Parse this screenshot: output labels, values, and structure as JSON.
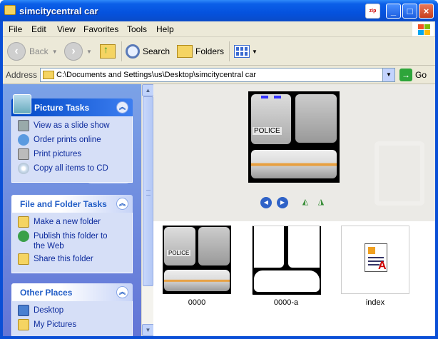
{
  "window": {
    "title": "simcitycentral car",
    "zip_label": "zip",
    "minimize": "_",
    "maximize": "□",
    "close": "×"
  },
  "menu": [
    "File",
    "Edit",
    "View",
    "Favorites",
    "Tools",
    "Help"
  ],
  "toolbar": {
    "back": "Back",
    "search": "Search",
    "folders": "Folders"
  },
  "address": {
    "label": "Address",
    "path": "C:\\Documents and Settings\\us\\Desktop\\simcitycentral car",
    "go": "Go"
  },
  "tasks": {
    "picture": {
      "title": "Picture Tasks",
      "items": [
        "View as a slide show",
        "Order prints online",
        "Print pictures",
        "Copy all items to CD"
      ]
    },
    "file_folder": {
      "title": "File and Folder Tasks",
      "items": [
        "Make a new folder",
        "Publish this folder to the Web",
        "Share this folder"
      ]
    },
    "other": {
      "title": "Other Places",
      "items": [
        "Desktop",
        "My Pictures"
      ]
    }
  },
  "preview": {
    "police_text": "POLICE"
  },
  "files": [
    {
      "name": "0000",
      "police_text": "POLICE"
    },
    {
      "name": "0000-a"
    },
    {
      "name": "index"
    }
  ],
  "colors": {
    "title_blue": "#0552de",
    "task_link": "#0c2a9c",
    "panel_bg": "#d6dff7"
  }
}
